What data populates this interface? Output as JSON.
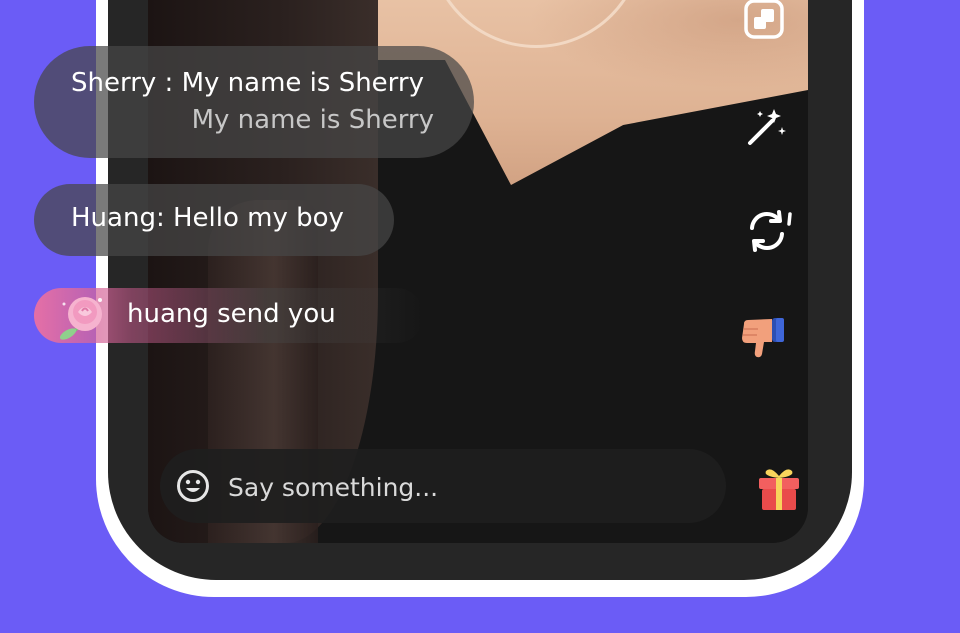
{
  "chat": {
    "messages": [
      {
        "text": "Sherry : My name is Sherry",
        "translation": "My name is Sherry"
      },
      {
        "text": "Huang: Hello my boy"
      },
      {
        "text": "huang send you",
        "gift_icon": "rose-icon"
      }
    ]
  },
  "input": {
    "placeholder": "Say something...",
    "emoji_icon": "smiley-icon"
  },
  "toolbar": {
    "icons": [
      "window-toggle-icon",
      "magic-wand-icon",
      "camera-flip-icon",
      "thumbs-down-icon",
      "gift-icon"
    ]
  },
  "colors": {
    "background": "#6b5cf6",
    "gift_bubble": "#e56fa6",
    "gift_box": "#e94b4b"
  }
}
